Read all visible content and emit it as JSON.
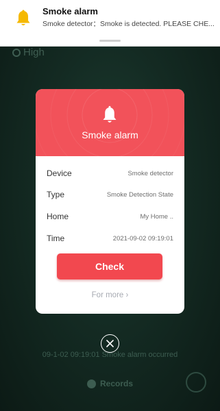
{
  "notification": {
    "title": "Smoke alarm",
    "body": "Smoke detector：Smoke is detected. PLEASE CHE...",
    "icon": "bell-icon",
    "icon_color": "#f5b800"
  },
  "background": {
    "level_text": "High",
    "event_text": "09-1-02 09:19:01 Smoke alarm occurred",
    "records_label": "Records"
  },
  "dialog": {
    "title": "Smoke alarm",
    "header_color": "#f2525a",
    "rows": [
      {
        "label": "Device",
        "value": "Smoke detector"
      },
      {
        "label": "Type",
        "value": "Smoke Detection State"
      },
      {
        "label": "Home",
        "value": "My Home .."
      },
      {
        "label": "Time",
        "value": "2021-09-02 09:19:01"
      }
    ],
    "check_label": "Check",
    "for_more_label": "For more ›",
    "accent_color": "#f2484f"
  }
}
